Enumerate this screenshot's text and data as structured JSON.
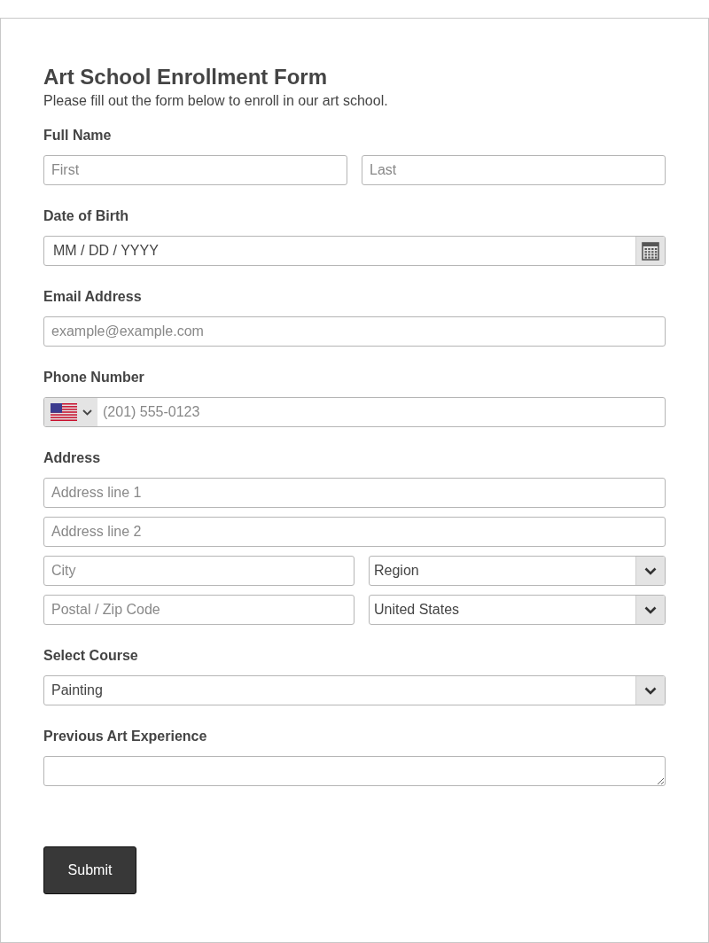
{
  "title": "Art School Enrollment Form",
  "subtitle": "Please fill out the form below to enroll in our art school.",
  "fields": [
    {
      "kind": "pair",
      "label": "Full Name",
      "inputs": [
        {
          "kind": "text",
          "placeholder": "First"
        },
        {
          "kind": "text",
          "placeholder": "Last"
        }
      ]
    },
    {
      "kind": "date",
      "label": "Date of Birth",
      "placeholder": "MM / DD / YYYY"
    },
    {
      "kind": "text",
      "label": "Email Address",
      "placeholder": "example@example.com"
    },
    {
      "kind": "phone",
      "label": "Phone Number",
      "placeholder": "(201) 555-0123"
    },
    {
      "kind": "address",
      "label": "Address",
      "rows": [
        [
          {
            "kind": "text",
            "placeholder": "Address line 1"
          }
        ],
        [
          {
            "kind": "text",
            "placeholder": "Address line 2"
          }
        ],
        [
          {
            "kind": "text",
            "placeholder": "City"
          },
          {
            "kind": "select",
            "value": "Region"
          }
        ],
        [
          {
            "kind": "text",
            "placeholder": "Postal / Zip Code"
          },
          {
            "kind": "select",
            "value": "United States"
          }
        ]
      ]
    },
    {
      "kind": "select",
      "label": "Select Course",
      "value": "Painting"
    },
    {
      "kind": "textarea",
      "label": "Previous Art Experience"
    }
  ],
  "submit": "Submit"
}
